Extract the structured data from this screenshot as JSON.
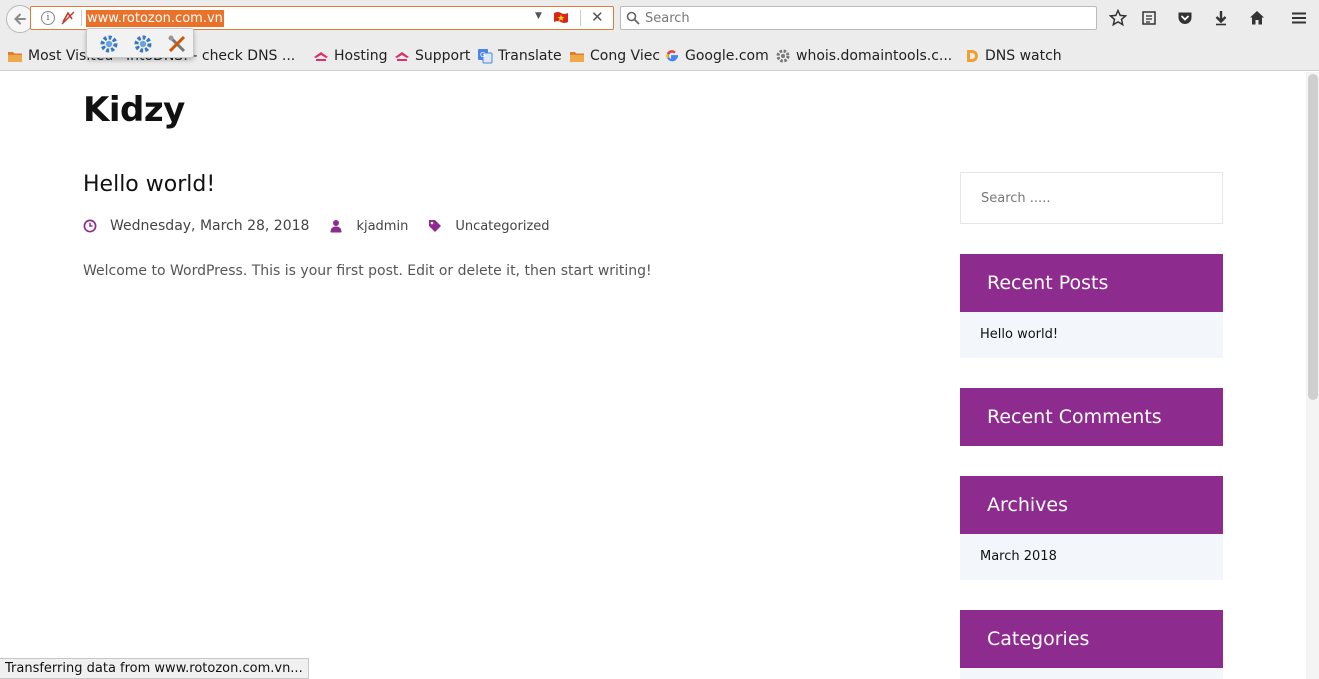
{
  "browser": {
    "url": "www.rotozon.com.vn",
    "search_placeholder": "Search",
    "bookmarks": [
      "Most Visited",
      "IntoDNS: - check DNS ...",
      "Hosting",
      "Support",
      "Translate",
      "Cong Viec",
      "Google.com",
      "whois.domaintools.c...",
      "DNS watch"
    ],
    "status": "Transferring data from www.rotozon.com.vn..."
  },
  "site": {
    "title": "Kidzy",
    "post": {
      "title": "Hello world!",
      "date": "Wednesday, March 28, 2018",
      "author": "kjadmin",
      "category": "Uncategorized",
      "excerpt": "Welcome to WordPress. This is your first post. Edit or delete it, then start writing!"
    },
    "sidebar": {
      "search_placeholder": "Search .....",
      "widgets": [
        {
          "title": "Recent Posts",
          "items": [
            "Hello world!"
          ]
        },
        {
          "title": "Recent Comments",
          "items": []
        },
        {
          "title": "Archives",
          "items": [
            "March 2018"
          ]
        },
        {
          "title": "Categories",
          "items": []
        }
      ]
    }
  },
  "colors": {
    "accent": "#8e2b8e",
    "url_highlight": "#e9712a",
    "widget_body": "#f3f6fa"
  }
}
